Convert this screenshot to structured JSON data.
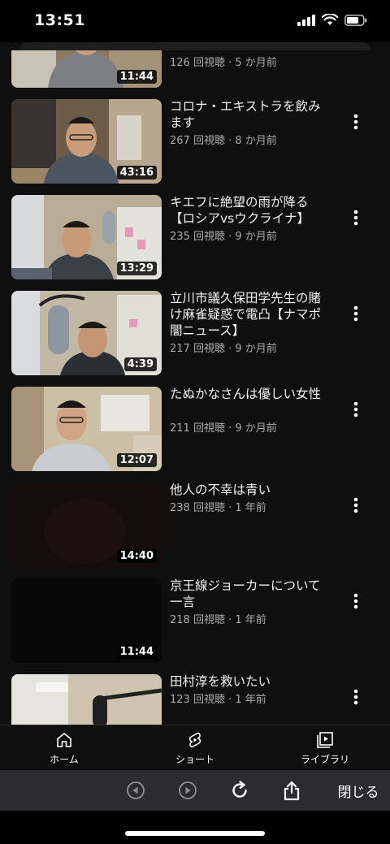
{
  "status": {
    "time": "13:51"
  },
  "videos": [
    {
      "title": "",
      "meta": "126 回視聴 · 5 か月前",
      "duration": "11:44"
    },
    {
      "title": "コロナ・エキストラを飲みます",
      "meta": "267 回視聴 · 8 か月前",
      "duration": "43:16"
    },
    {
      "title": "キエフに絶望の雨が降る【ロシアvsウクライナ】",
      "meta": "235 回視聴 · 9 か月前",
      "duration": "13:29"
    },
    {
      "title": "立川市議久保田学先生の賭け麻雀疑惑で電凸【ナマポ闇ニュース】",
      "meta": "217 回視聴 · 9 か月前",
      "duration": "4:39"
    },
    {
      "title": "たぬかなさんは優しい女性",
      "meta": "211 回視聴 · 9 か月前",
      "duration": "12:07"
    },
    {
      "title": "他人の不幸は青い",
      "meta": "238 回視聴 · 1 年前",
      "duration": "14:40"
    },
    {
      "title": "京王線ジョーカーについて一言",
      "meta": "218 回視聴 · 1 年前",
      "duration": "11:44"
    },
    {
      "title": "田村淳を救いたい",
      "meta": "123 回視聴 · 1 年前",
      "duration": ""
    }
  ],
  "bottom_nav": [
    {
      "label": "ホーム",
      "icon": "home-icon"
    },
    {
      "label": "ショート",
      "icon": "shorts-icon"
    },
    {
      "label": "ライブラリ",
      "icon": "library-icon"
    }
  ],
  "browser_bar": {
    "close_label": "閉じる"
  },
  "colors": {
    "background": "#0f0f0f",
    "meta_text": "#aaaaaa",
    "browser_bar": "#2c2c2e"
  }
}
